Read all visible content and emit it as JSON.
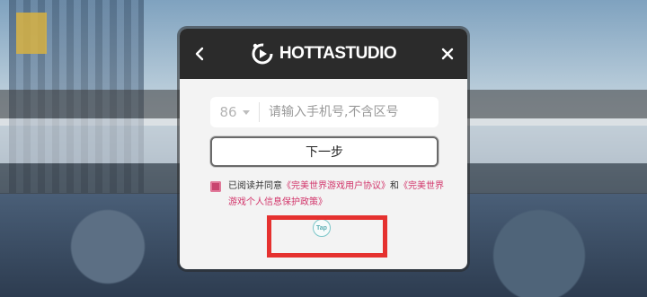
{
  "dialog": {
    "logo_text": "HOTTASTUDIO",
    "back_icon": "chevron-left-icon",
    "close_icon": "close-icon"
  },
  "phone": {
    "country_code": "86",
    "placeholder": "请输入手机号,不含区号",
    "value": ""
  },
  "next_button": {
    "label": "下一步"
  },
  "agreement": {
    "checked": true,
    "prefix": "已阅读并同意",
    "link1": "《完美世界游戏用户协议》",
    "and": "和",
    "link2": "《完美世界游戏个人信息保护政策》"
  },
  "tap_badge": {
    "label": "Tap"
  },
  "colors": {
    "header": "#2b2b2b",
    "dialog_bg": "#f3f3f3",
    "link": "#d2346a",
    "checkbox": "#c8456f",
    "highlight": "#e5312f"
  }
}
